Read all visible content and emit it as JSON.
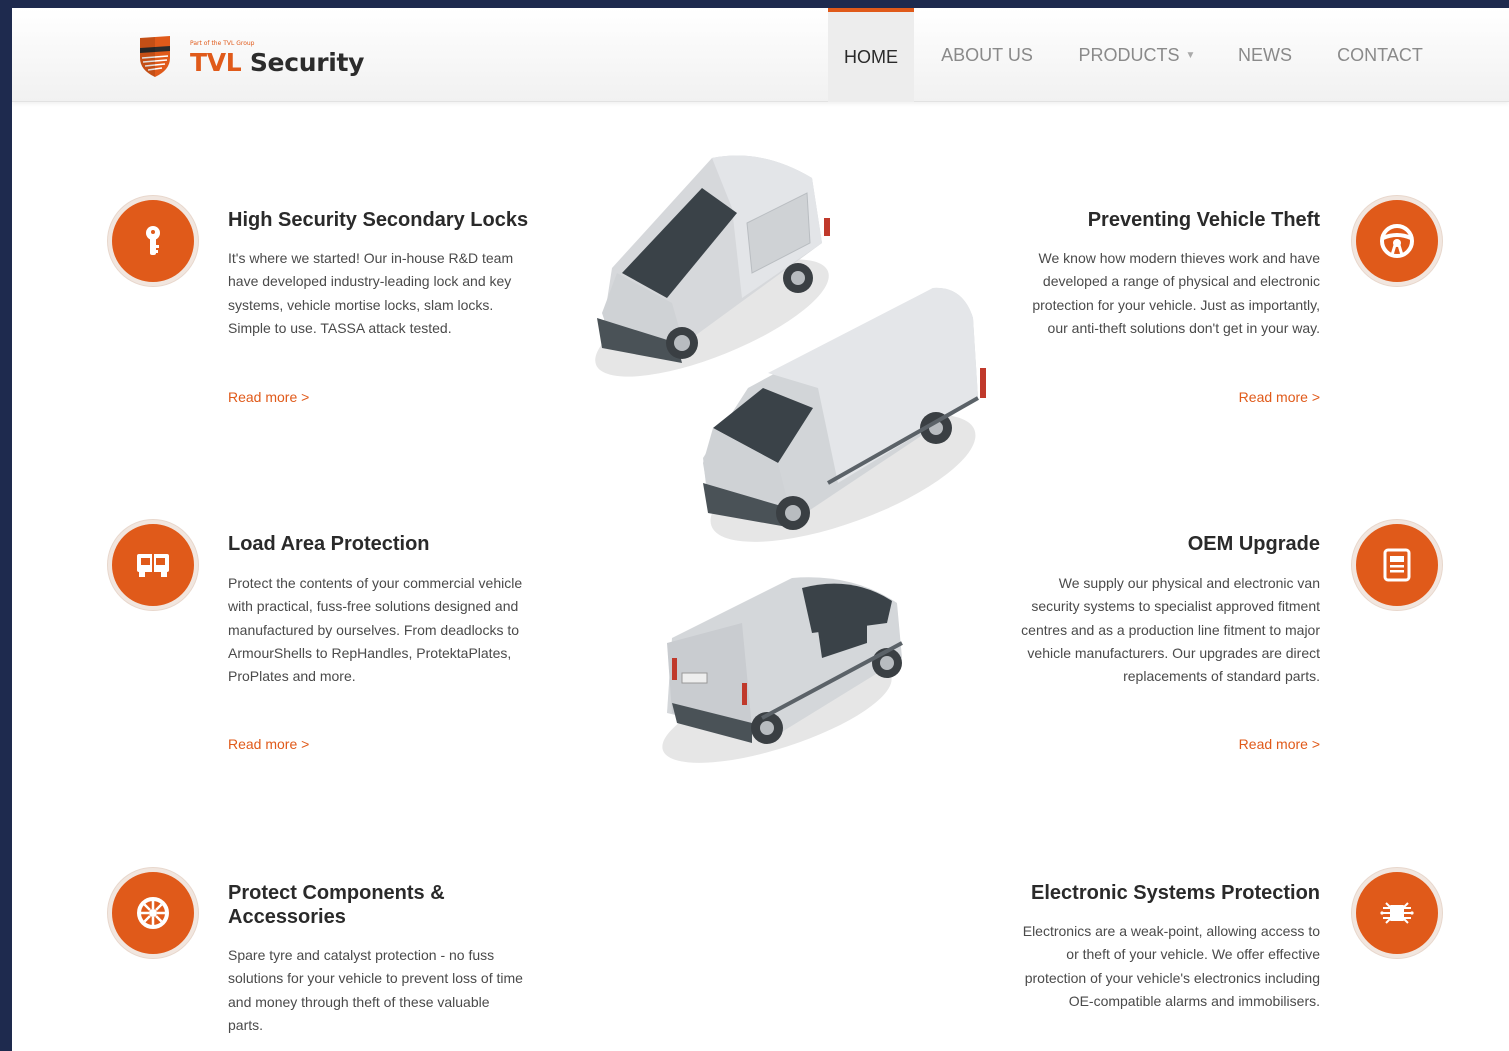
{
  "brand": {
    "tagline": "Part of the TVL Group",
    "name_accent": "TVL",
    "name_rest": "Security",
    "accent_color": "#e05a1a"
  },
  "nav": {
    "items": [
      {
        "label": "HOME",
        "active": true
      },
      {
        "label": "ABOUT US",
        "active": false
      },
      {
        "label": "PRODUCTS",
        "active": false,
        "dropdown": true
      },
      {
        "label": "NEWS",
        "active": false
      },
      {
        "label": "CONTACT",
        "active": false
      }
    ]
  },
  "features": [
    {
      "title": "High Security Secondary Locks",
      "text": "It's where we started! Our in-house R&D team have developed industry-leading lock and key systems, vehicle mortise locks, slam locks. Simple to use. TASSA attack tested.",
      "more": "Read more >",
      "icon": "key-icon"
    },
    {
      "title": "Preventing Vehicle Theft",
      "text": "We know how modern thieves work and have developed a range of physical and electronic protection for your vehicle. Just as importantly, our anti-theft solutions don't get in your way.",
      "more": "Read more >",
      "icon": "steering-wheel-icon"
    },
    {
      "title": "Load Area Protection",
      "text": "Protect the contents of your commercial vehicle with practical, fuss-free solutions designed and manufactured by ourselves. From deadlocks to ArmourShells to RepHandles, ProtektaPlates, ProPlates and more.",
      "more": "Read more >",
      "icon": "van-doors-icon"
    },
    {
      "title": "OEM Upgrade",
      "text": "We supply our physical and electronic van security systems to specialist approved fitment centres and as a production line fitment to major vehicle manufacturers. Our upgrades are direct replacements of standard parts.",
      "more": "Read more >",
      "icon": "document-icon"
    },
    {
      "title": "Protect Components & Accessories",
      "text": "Spare tyre and catalyst protection - no fuss solutions for your vehicle to prevent loss of time and money through theft of these valuable parts.",
      "icon": "wheel-icon"
    },
    {
      "title": "Electronic Systems Protection",
      "text": "Electronics are a weak-point, allowing access to or theft of your vehicle. We offer effective protection of your vehicle's electronics including OE-compatible alarms and immobilisers.",
      "icon": "microchip-icon"
    }
  ]
}
